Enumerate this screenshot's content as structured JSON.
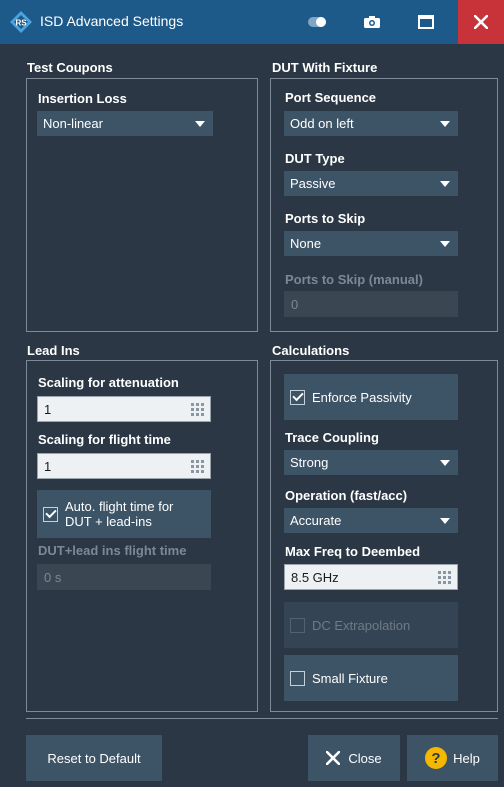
{
  "window": {
    "title": "ISD Advanced Settings",
    "icons": [
      "rs-logo-icon",
      "toggle-icon",
      "camera-icon",
      "maximize-icon",
      "close-icon"
    ]
  },
  "test_coupons": {
    "title": "Test Coupons",
    "insertion_loss": {
      "label": "Insertion Loss",
      "value": "Non-linear"
    }
  },
  "dut_with_fixture": {
    "title": "DUT With Fixture",
    "port_sequence": {
      "label": "Port Sequence",
      "value": "Odd on left"
    },
    "dut_type": {
      "label": "DUT Type",
      "value": "Passive"
    },
    "ports_to_skip": {
      "label": "Ports to Skip",
      "value": "None"
    },
    "ports_to_skip_manual": {
      "label": "Ports to Skip (manual)",
      "value": "0"
    }
  },
  "lead_ins": {
    "title": "Lead Ins",
    "scaling_attenuation": {
      "label": "Scaling for attenuation",
      "value": "1"
    },
    "scaling_flight_time": {
      "label": "Scaling for flight time",
      "value": "1"
    },
    "auto_flight_time": {
      "label_line1": "Auto. flight time for",
      "label_line2": "DUT + lead-ins",
      "checked": true
    },
    "dut_lead_flight_time": {
      "label": "DUT+lead ins flight time",
      "value": "0 s"
    }
  },
  "calculations": {
    "title": "Calculations",
    "enforce_passivity": {
      "label": "Enforce Passivity",
      "checked": true
    },
    "trace_coupling": {
      "label": "Trace Coupling",
      "value": "Strong"
    },
    "operation": {
      "label": "Operation (fast/acc)",
      "value": "Accurate"
    },
    "max_freq": {
      "label": "Max Freq to Deembed",
      "value": "8.5 GHz"
    },
    "dc_extrapolation": {
      "label": "DC Extrapolation",
      "checked": false
    },
    "small_fixture": {
      "label": "Small Fixture",
      "checked": false
    }
  },
  "footer": {
    "reset_label": "Reset to Default",
    "close_label": "Close",
    "help_label": "Help"
  },
  "colors": {
    "background": "#2b3744",
    "titlebar": "#1d5a8a",
    "control": "#3d5366",
    "close": "#c8333a",
    "help_icon": "#f5b800"
  }
}
